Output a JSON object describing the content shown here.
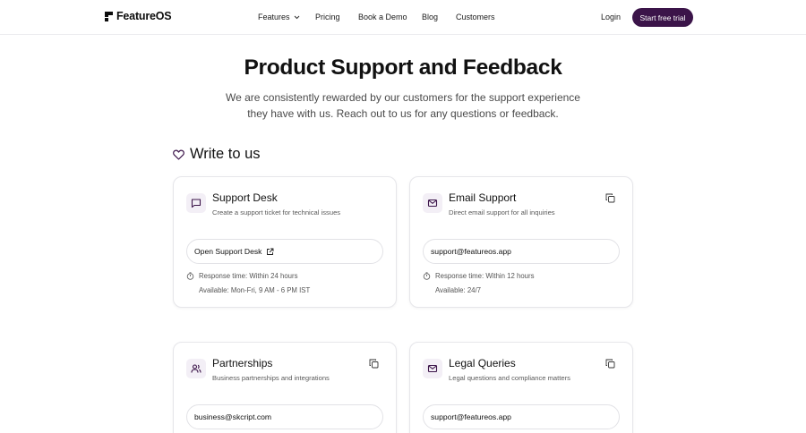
{
  "nav": {
    "logo_text": "FeatureOS",
    "links": [
      "Features",
      "Pricing",
      "Book a Demo",
      "Blog",
      "Customers"
    ],
    "login": "Login",
    "cta": "Start free trial"
  },
  "hero": {
    "title": "Product Support and Feedback",
    "subtitle": "We are consistently rewarded by our customers for the support experience they have with us. Reach out to us for any questions or feedback."
  },
  "section": {
    "title": "Write to us"
  },
  "cards": [
    {
      "title": "Support Desk",
      "description": "Create a support ticket for technical issues",
      "action": "Open Support Desk",
      "response": "Response time: Within 24 hours",
      "availability": "Available: Mon-Fri, 9 AM - 6 PM IST"
    },
    {
      "title": "Email Support",
      "description": "Direct email support for all inquiries",
      "action": "support@featureos.app",
      "response": "Response time: Within 12 hours",
      "availability": "Available: 24/7"
    },
    {
      "title": "Partnerships",
      "description": "Business partnerships and integrations",
      "action": "business@skcript.com"
    },
    {
      "title": "Legal Queries",
      "description": "Legal questions and compliance matters",
      "action": "support@featureos.app"
    }
  ],
  "colors": {
    "accent": "#3b1449",
    "icon_bg": "#f3eff6"
  }
}
